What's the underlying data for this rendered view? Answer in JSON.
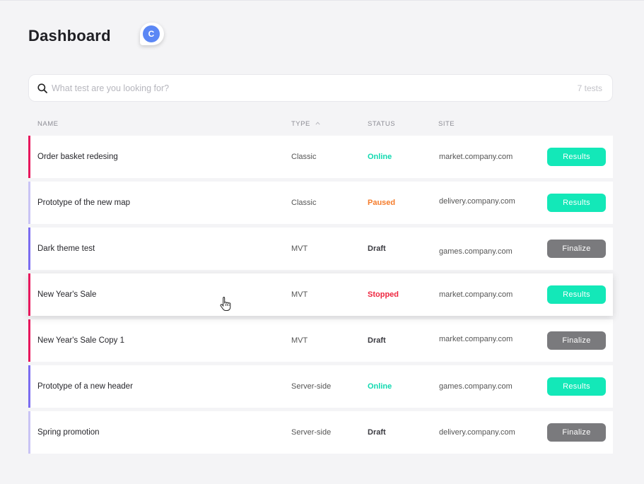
{
  "page": {
    "title": "Dashboard"
  },
  "avatar": {
    "initial": "C",
    "color": "#5b87f5"
  },
  "search": {
    "placeholder": "What test are you looking for?",
    "value": "",
    "count": "7 tests"
  },
  "table": {
    "columns": {
      "name": "NAME",
      "type": "TYPE",
      "status": "STATUS",
      "site": "SITE"
    },
    "rows": [
      {
        "name": "Order basket redesing",
        "type": "Classic",
        "status": "Online",
        "site": "market.company.com",
        "action": "Results",
        "bar_color": "#e8175d",
        "status_color": "#11d9b0",
        "button_color": "#13e8b8"
      },
      {
        "name": "Prototype of the new map",
        "type": "Classic",
        "status": "Paused",
        "site": "delivery.company.com",
        "action": "Results",
        "bar_color": "#c9c4f5",
        "status_color": "#f57c2b",
        "button_color": "#13e8b8"
      },
      {
        "name": "Dark theme test",
        "type": "MVT",
        "status": "Draft",
        "site": "games.company.com",
        "action": "Finalize",
        "bar_color": "#7b6cf0",
        "status_color": "#3a3a40",
        "button_color": "#7a7a7d"
      },
      {
        "name": "New Year's Sale",
        "type": "MVT",
        "status": "Stopped",
        "site": "market.company.com",
        "action": "Results",
        "bar_color": "#e8175d",
        "status_color": "#ee2740",
        "button_color": "#13e8b8"
      },
      {
        "name": "New Year's Sale Copy 1",
        "type": "MVT",
        "status": "Draft",
        "site": "market.company.com",
        "action": "Finalize",
        "bar_color": "#e8175d",
        "status_color": "#3a3a40",
        "button_color": "#7a7a7d"
      },
      {
        "name": "Prototype of a new header",
        "type": "Server-side",
        "status": "Online",
        "site": "games.company.com",
        "action": "Results",
        "bar_color": "#7b6cf0",
        "status_color": "#11d9b0",
        "button_color": "#13e8b8"
      },
      {
        "name": "Spring promotion",
        "type": "Server-side",
        "status": "Draft",
        "site": "delivery.company.com",
        "action": "Finalize",
        "bar_color": "#c9c4f5",
        "status_color": "#3a3a40",
        "button_color": "#7a7a7d"
      }
    ]
  }
}
